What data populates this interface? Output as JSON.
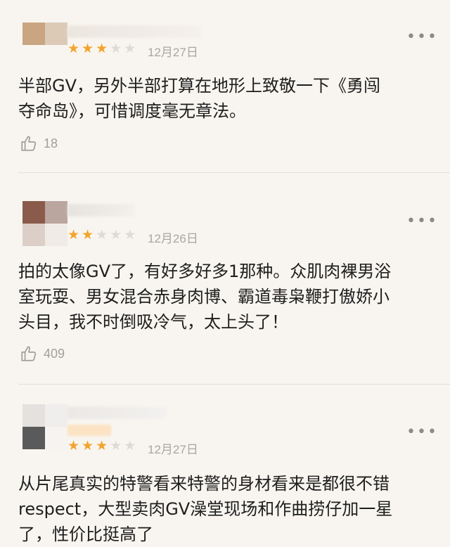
{
  "reviews": [
    {
      "rating": 3,
      "max_rating": 5,
      "date": "12月27日",
      "content": "半部GV，另外半部打算在地形上致敬一下《勇闯\n夺命岛》，可惜调度毫无章法。",
      "likes": "18",
      "more_label": "•••",
      "like_icon": "thumbs-up-icon",
      "avatar_colors": [
        "#c9a581",
        "#dccab7"
      ]
    },
    {
      "rating": 2,
      "max_rating": 5,
      "date": "12月26日",
      "content": "拍的太像GV了，有好多好多1那种。众肌肉裸男浴\n室玩耍、男女混合赤身肉博、霸道毒枭鞭打傲娇小\n头目，我不时倒吸冷气，太上头了！",
      "likes": "409",
      "more_label": "•••",
      "like_icon": "thumbs-up-icon",
      "avatar_colors": [
        "#8a5b4b",
        "#bba59f",
        "#dccfc7",
        "#f1ebe7"
      ]
    },
    {
      "rating": 3,
      "max_rating": 5,
      "date": "12月27日",
      "content": "从片尾真实的特警看来特警的身材看来是都很不错\nrespect，大型卖肉GV澡堂现场和作曲捞仔加一星\n了，性价比挺高了",
      "more_label": "•••",
      "avatar_colors": [
        "#e4e1de",
        "#f0eeec",
        "#5a5a5a",
        "#fbe3c3"
      ]
    }
  ],
  "colors": {
    "star_on": "#f3a42c",
    "star_off": "#dedad4",
    "background": "#f8f5f0"
  }
}
